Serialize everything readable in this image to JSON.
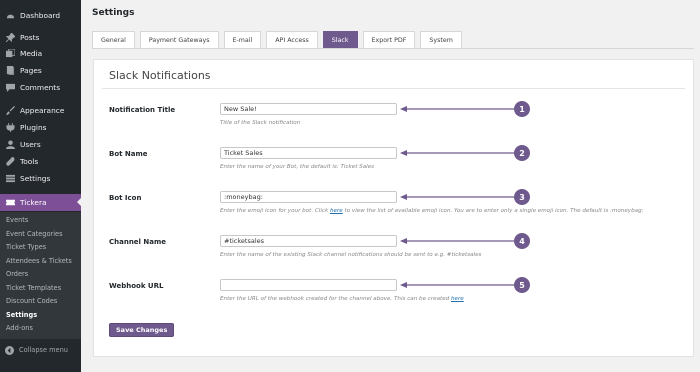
{
  "sidebar": {
    "menu": [
      {
        "label": "Dashboard",
        "icon": "dashboard-icon"
      },
      {
        "label": "Posts",
        "icon": "pin-icon"
      },
      {
        "label": "Media",
        "icon": "media-icon"
      },
      {
        "label": "Pages",
        "icon": "page-icon"
      },
      {
        "label": "Comments",
        "icon": "comment-icon"
      },
      {
        "label": "Appearance",
        "icon": "brush-icon"
      },
      {
        "label": "Plugins",
        "icon": "plug-icon"
      },
      {
        "label": "Users",
        "icon": "user-icon"
      },
      {
        "label": "Tools",
        "icon": "wrench-icon"
      },
      {
        "label": "Settings",
        "icon": "settings-icon"
      },
      {
        "label": "Tickera",
        "icon": "ticket-icon"
      }
    ],
    "submenu": [
      "Events",
      "Event Categories",
      "Ticket Types",
      "Attendees & Tickets",
      "Orders",
      "Ticket Templates",
      "Discount Codes",
      "Settings",
      "Add-ons"
    ],
    "collapse_label": "Collapse menu"
  },
  "page_title": "Settings",
  "tabs": [
    "General",
    "Payment Gateways",
    "E-mail",
    "API Access",
    "Slack",
    "Export PDF",
    "System"
  ],
  "panel": {
    "title": "Slack Notifications",
    "fields": [
      {
        "label": "Notification Title",
        "value": "New Sale!",
        "desc": "Title of the Slack notification",
        "badge": "1"
      },
      {
        "label": "Bot Name",
        "value": "Ticket Sales",
        "desc": "Enter the name of your Bot, the default is: Ticket Sales",
        "badge": "2"
      },
      {
        "label": "Bot Icon",
        "value": ":moneybag:",
        "desc_before": "Enter the emoji icon for your bot. Click ",
        "desc_link": "here",
        "desc_after": " to view the list of available emoji icon. You are to enter only a single emoji icon. The default is :moneybag:",
        "badge": "3"
      },
      {
        "label": "Channel Name",
        "value": "#ticketsales",
        "desc": "Enter the name of the existing Slack channel notifications should be sent to e.g. #ticketsales",
        "badge": "4"
      },
      {
        "label": "Webhook URL",
        "value": "",
        "desc_before": "Enter the URL of the webhook created for the channel above. This can be created ",
        "desc_link": "here",
        "desc_after": "",
        "badge": "5"
      }
    ],
    "save_label": "Save Changes"
  },
  "colors": {
    "accent": "#6f5a8e",
    "sidebar": "#23282d",
    "active_menu": "#7c4f96"
  }
}
